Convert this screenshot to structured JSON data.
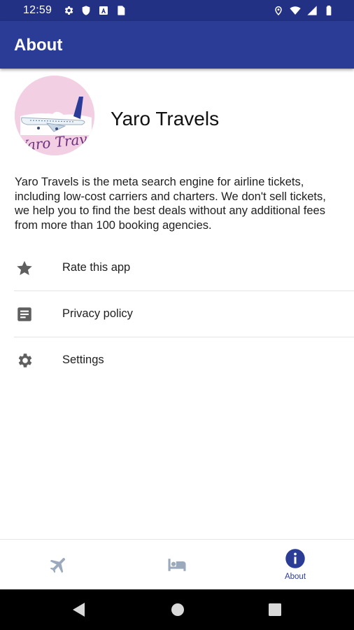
{
  "status_bar": {
    "time": "12:59",
    "icons_left": [
      "gear-icon",
      "shield-icon",
      "a-badge-icon",
      "sd-card-icon"
    ],
    "icons_right": [
      "location-icon",
      "wifi-icon",
      "signal-icon",
      "battery-icon"
    ]
  },
  "app_bar": {
    "title": "About"
  },
  "app": {
    "name": "Yaro Travels",
    "logo_text": "Yaro Travels",
    "description": "Yaro Travels is the meta search engine for airline tickets, including low-cost carriers and charters. We don't sell tickets, we help you to find the best deals without any additional fees from more than 100 booking agencies."
  },
  "menu": [
    {
      "icon": "star-icon",
      "label": "Rate this app"
    },
    {
      "icon": "document-icon",
      "label": "Privacy policy"
    },
    {
      "icon": "gear-icon",
      "label": "Settings"
    }
  ],
  "bottom_nav": {
    "tabs": [
      {
        "icon": "airplane-icon",
        "label": "",
        "active": false
      },
      {
        "icon": "hotel-bed-icon",
        "label": "",
        "active": false
      },
      {
        "icon": "info-icon",
        "label": "About",
        "active": true
      }
    ]
  },
  "colors": {
    "status_bar": "#233184",
    "app_bar": "#2b3c96",
    "accent": "#2b3c96",
    "inactive_nav_icon": "#9aa9bb",
    "menu_icon": "#5f5f5f",
    "logo_background": "#f3cfe4",
    "logo_text": "#6a2f7a"
  }
}
